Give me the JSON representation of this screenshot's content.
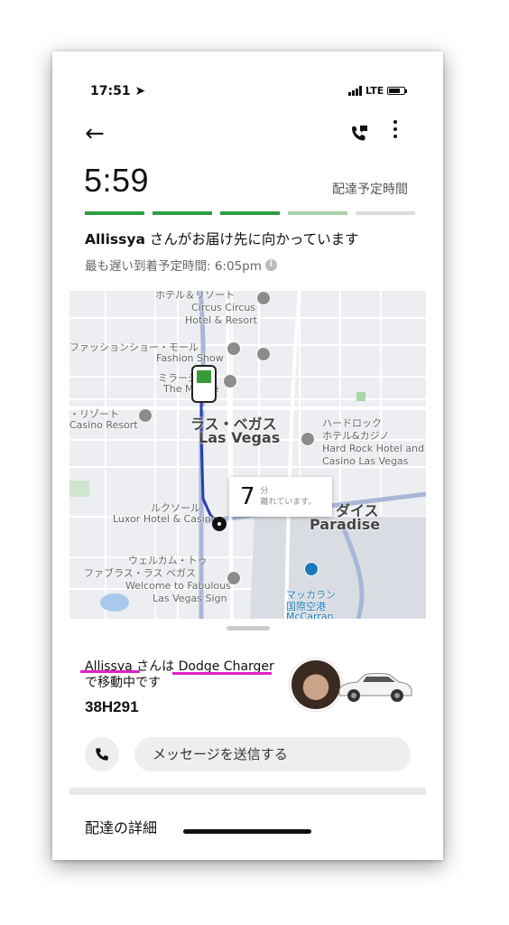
{
  "status_bar": {
    "time": "17:51",
    "network": "LTE"
  },
  "header": {
    "back_icon": "arrow-left-icon",
    "call_icon": "phone-chat-icon",
    "menu_icon": "more-vertical-icon"
  },
  "delivery": {
    "eta_time": "5:59",
    "eta_label": "配達予定時間",
    "progress_colors": [
      "#2e9e44",
      "#2e9e44",
      "#2e9e44",
      "#a7d3a9",
      "#dddddd"
    ],
    "driver_name": "Allissya",
    "status_text": "さんがお届け先に向かっています",
    "latest_arrival": "最も遅い到着予定時間: 6:05pm"
  },
  "map": {
    "labels": {
      "hotel_resort_top": "ホテル＆リゾート",
      "circus_circus": "Circus Circus",
      "hotel_and_resort": "Hotel & Resort",
      "fashion_show_jp": "ファッションショー・モール",
      "fashion_show": "Fashion Show",
      "mirage_jp": "ミラージュ",
      "the_mirage": "The Mirage",
      "resort_jp": "・リゾート",
      "casino_resort": "Casino Resort",
      "las_vegas_jp": "ラス・ベガス",
      "las_vegas": "Las Vegas",
      "hard_rock_jp1": "ハードロック",
      "hard_rock_jp2": "ホテル&カジノ",
      "hard_rock_en1": "Hard Rock Hotel and",
      "hard_rock_en2": "Casino Las Vegas",
      "luxor_jp": "ルクソール",
      "luxor": "Luxor Hotel & Casino",
      "paradise_jp": "ダイス",
      "paradise": "Paradise",
      "welcome_jp1": "ウェルカム・トゥ",
      "welcome_jp2": "ファブラス・ラス ベガス",
      "welcome1": "Welcome to Fabulous",
      "welcome2": "Las Vegas Sign",
      "mccarran_jp1": "マッカラン",
      "mccarran_jp2": "国際空港",
      "mccarran": "McCarran"
    },
    "eta_bubble": {
      "minutes": "7",
      "unit": "分",
      "note": "離れています。"
    }
  },
  "driver": {
    "name": "Allissya",
    "connector": "さんは",
    "vehicle": "Dodge Charger",
    "moving": "で移動中です",
    "plate": "38H291"
  },
  "actions": {
    "message_placeholder": "メッセージを送信する"
  },
  "footer": {
    "details_label": "配達の詳細"
  }
}
